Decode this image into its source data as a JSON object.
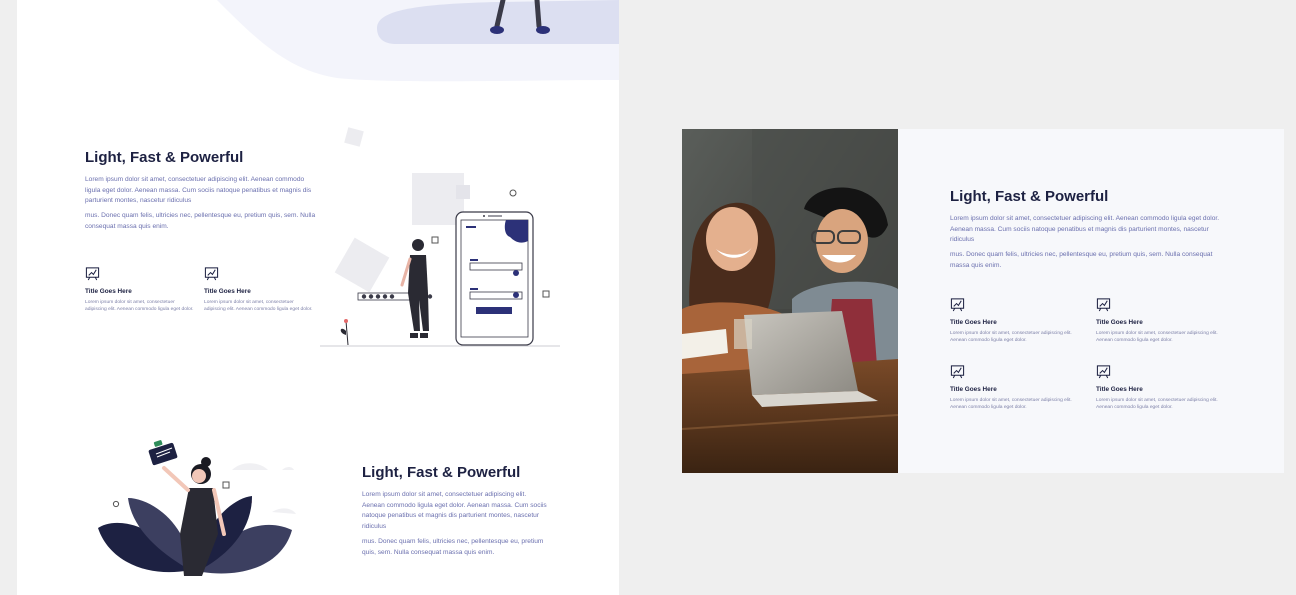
{
  "colors": {
    "navy": "#1d2142",
    "link_blue": "#6a6fae",
    "muted_text": "#7d80a8",
    "blob": "#dcdff1",
    "page_bg": "#efefef",
    "card_bg": "#f7f8fb"
  },
  "left_panel": {
    "section_1": {
      "title": "Light, Fast & Powerful",
      "paragraph_1": "Lorem ipsum dolor sit amet, consectetuer adipiscing elit. Aenean commodo ligula eget dolor. Aenean massa. Cum sociis natoque penatibus et magnis dis parturient montes, nascetur ridiculus",
      "paragraph_2": "mus. Donec quam felis, ultricies nec, pellentesque eu, pretium quis, sem. Nulla consequat massa quis enim.",
      "features": [
        {
          "icon": "presentation-chart-icon",
          "title": "Title Goes Here",
          "text": "Lorem ipsum dolor sit amet, consectetuer adipiscing elit. Aenean commodo ligula eget dolor."
        },
        {
          "icon": "presentation-chart-icon",
          "title": "Title Goes Here",
          "text": "Lorem ipsum dolor sit amet, consectetuer adipiscing elit. Aenean commodo ligula eget dolor."
        }
      ]
    },
    "section_2": {
      "title": "Light, Fast & Powerful",
      "paragraph_1": "Lorem ipsum dolor sit amet, consectetuer adipiscing elit. Aenean commodo ligula eget dolor. Aenean massa. Cum sociis natoque penatibus et magnis dis parturient montes, nascetur ridiculus",
      "paragraph_2": "mus. Donec quam felis, ultricies nec, pellentesque eu, pretium quis, sem. Nulla consequat massa quis enim."
    }
  },
  "right_panel": {
    "title": "Light, Fast & Powerful",
    "paragraph_1": "Lorem ipsum dolor sit amet, consectetuer adipiscing elit. Aenean commodo ligula eget dolor. Aenean massa. Cum sociis natoque penatibus et magnis dis parturient montes, nascetur ridiculus",
    "paragraph_2": "mus. Donec quam felis, ultricies nec, pellentesque eu, pretium quis, sem. Nulla consequat massa quis enim.",
    "features": [
      {
        "icon": "presentation-chart-icon",
        "title": "Title Goes Here",
        "text": "Lorem ipsum dolor sit amet, consectetuer adipiscing elit. Aenean commodo ligula eget dolor."
      },
      {
        "icon": "presentation-chart-icon",
        "title": "Title Goes Here",
        "text": "Lorem ipsum dolor sit amet, consectetuer adipiscing elit. Aenean commodo ligula eget dolor."
      },
      {
        "icon": "presentation-chart-icon",
        "title": "Title Goes Here",
        "text": "Lorem ipsum dolor sit amet, consectetuer adipiscing elit. Aenean commodo ligula eget dolor."
      },
      {
        "icon": "presentation-chart-icon",
        "title": "Title Goes Here",
        "text": "Lorem ipsum dolor sit amet, consectetuer adipiscing elit. Aenean commodo ligula eget dolor."
      }
    ]
  }
}
